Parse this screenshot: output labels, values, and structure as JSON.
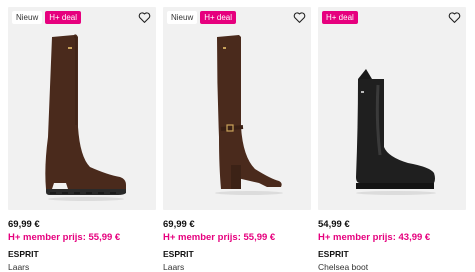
{
  "products": [
    {
      "badges": [
        "Nieuw",
        "H+ deal"
      ],
      "price": "69,99 €",
      "member_price": "H+ member prijs: 55,99 €",
      "brand": "ESPRIT",
      "type": "Laars",
      "image": "brown-suede-knee-high-boot-lug-sole"
    },
    {
      "badges": [
        "Nieuw",
        "H+ deal"
      ],
      "price": "69,99 €",
      "member_price": "H+ member prijs: 55,99 €",
      "brand": "ESPRIT",
      "type": "Laars",
      "image": "brown-suede-knee-high-boot-block-heel-buckle"
    },
    {
      "badges": [
        "H+ deal"
      ],
      "price": "54,99 €",
      "member_price": "H+ member prijs: 43,99 €",
      "brand": "ESPRIT",
      "type": "Chelsea boot",
      "image": "black-leather-chelsea-boot"
    }
  ],
  "colors": {
    "deal": "#e6007e",
    "card_bg": "#f1f1f1",
    "suede": "#4a2a1c",
    "leather": "#1f1f1f"
  },
  "icons": {
    "favorite": "heart-outline-icon"
  }
}
